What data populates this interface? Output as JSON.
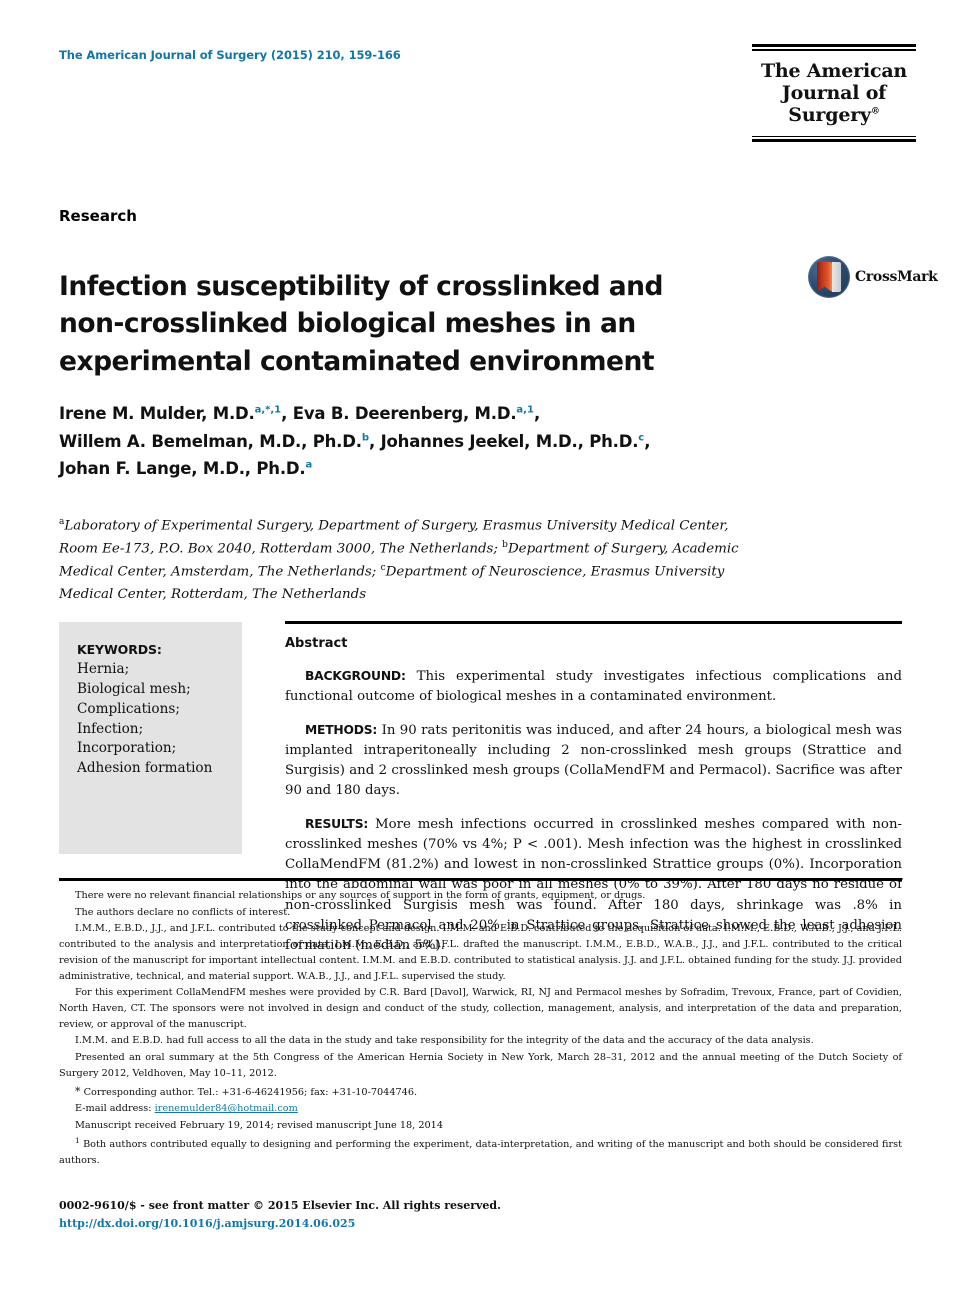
{
  "header": {
    "journal_reference": "The American Journal of Surgery (2015) 210, 159-166",
    "logo_line1": "The American",
    "logo_line2": "Journal of Surgery",
    "logo_trademark": "®"
  },
  "article": {
    "section_label": "Research",
    "title_lines": [
      "Infection susceptibility of crosslinked and",
      "non-crosslinked biological meshes in an",
      "experimental contaminated environment"
    ],
    "crossmark_label": "CrossMark"
  },
  "authors": {
    "lines": [
      {
        "parts": [
          {
            "text": "Irene M. Mulder, M.D.",
            "sup": ""
          },
          {
            "text": "",
            "sup": "a,*,1"
          },
          {
            "text": ", Eva B. Deerenberg, M.D.",
            "sup": ""
          },
          {
            "text": "",
            "sup": "a,1"
          },
          {
            "text": ",",
            "sup": ""
          }
        ]
      },
      {
        "parts": [
          {
            "text": "Willem A. Bemelman, M.D., Ph.D.",
            "sup": ""
          },
          {
            "text": "",
            "sup": "b"
          },
          {
            "text": ", Johannes Jeekel, M.D., Ph.D.",
            "sup": ""
          },
          {
            "text": "",
            "sup": "c"
          },
          {
            "text": ",",
            "sup": ""
          }
        ]
      },
      {
        "parts": [
          {
            "text": "Johan F. Lange, M.D., Ph.D.",
            "sup": ""
          },
          {
            "text": "",
            "sup": "a"
          }
        ]
      }
    ]
  },
  "affiliations": {
    "text": "Laboratory of Experimental Surgery, Department of Surgery, Erasmus University Medical Center, Room Ee-173, P.O. Box 2040, Rotterdam 3000, The Netherlands; Department of Surgery, Academic Medical Center, Amsterdam, The Netherlands; Department of Neuroscience, Erasmus University Medical Center, Rotterdam, The Netherlands",
    "markers": [
      "a",
      "b",
      "c"
    ]
  },
  "keywords": {
    "title": "KEYWORDS:",
    "items": [
      "Hernia;",
      "Biological mesh;",
      "Complications;",
      "Infection;",
      "Incorporation;",
      "Adhesion formation"
    ]
  },
  "abstract": {
    "heading": "Abstract",
    "sections": [
      {
        "label": "BACKGROUND:",
        "text": "This experimental study investigates infectious complications and functional outcome of biological meshes in a contaminated environment."
      },
      {
        "label": "METHODS:",
        "text": "In 90 rats peritonitis was induced, and after 24 hours, a biological mesh was implanted intraperitoneally including 2 non-crosslinked mesh groups (Strattice and Surgisis) and 2 crosslinked mesh groups (CollaMendFM and Permacol). Sacrifice was after 90 and 180 days."
      },
      {
        "label": "RESULTS:",
        "text": "More mesh infections occurred in crosslinked meshes compared with non-crosslinked meshes (70% vs 4%; P < .001). Mesh infection was the highest in crosslinked CollaMendFM (81.2%) and lowest in non-crosslinked Strattice groups (0%). Incorporation into the abdominal wall was poor in all meshes (0% to 39%). After 180 days no residue of non-crosslinked Surgisis mesh was found. After 180 days, shrinkage was .8% in crosslinked Permacol and 20% in Strattice groups. Strattice showed the least adhesion formation (median 5%)."
      }
    ]
  },
  "footnotes": {
    "disclosure": "There were no relevant financial relationships or any sources of support in the form of grants, equipment, or drugs.",
    "conflicts": "The authors declare no conflicts of interest.",
    "contributions": "I.M.M., E.B.D., J.J., and J.F.L. contributed to the study concept and design. I.M.M. and E.B.D. contributed to the acquisition of data. I.M.M., E.B.D., W.A.B., J.J., and J.F.L. contributed to the analysis and interpretation of data. I.M.M., E.B.D., and J.F.L. drafted the manuscript. I.M.M., E.B.D., W.A.B., J.J., and J.F.L. contributed to the critical revision of the manuscript for important intellectual content. I.M.M. and E.B.D. contributed to statistical analysis. J.J. and J.F.L. obtained funding for the study. J.J. provided administrative, technical, and material support. W.A.B., J.J., and J.F.L. supervised the study.",
    "sponsors": "For this experiment CollaMendFM meshes were provided by C.R. Bard [Davol], Warwick, RI, NJ and Permacol meshes by Sofradim, Trevoux, France, part of Covidien, North Haven, CT. The sponsors were not involved in design and conduct of the study, collection, management, analysis, and interpretation of the data and preparation, review, or approval of the manuscript.",
    "data_access": "I.M.M. and E.B.D. had full access to all the data in the study and take responsibility for the integrity of the data and the accuracy of the data analysis.",
    "presented": "Presented an oral summary at the 5th Congress of the American Hernia Society in New York, March 28–31, 2012 and the annual meeting of the Dutch Society of Surgery 2012, Veldhoven, May 10–11, 2012.",
    "corresponding_marker": "*",
    "corresponding": "Corresponding author. Tel.: +31-6-46241956; fax: +31-10-7044746.",
    "email_label": "E-mail address:",
    "email": "irenemulder84@hotmail.com",
    "manuscript_dates": "Manuscript received February 19, 2014; revised manuscript June 18, 2014",
    "equal_contribution_marker": "1",
    "equal_contribution": "Both authors contributed equally to designing and performing the experiment, data-interpretation, and writing of the manuscript and both should be considered first authors."
  },
  "footer": {
    "copyright": "0002-9610/$ - see front matter © 2015 Elsevier Inc. All rights reserved.",
    "doi": "http://dx.doi.org/10.1016/j.amjsurg.2014.06.025"
  },
  "colors": {
    "accent_blue": "#1277a8",
    "keywords_background": "#e3e3e3",
    "text": "#111111"
  }
}
